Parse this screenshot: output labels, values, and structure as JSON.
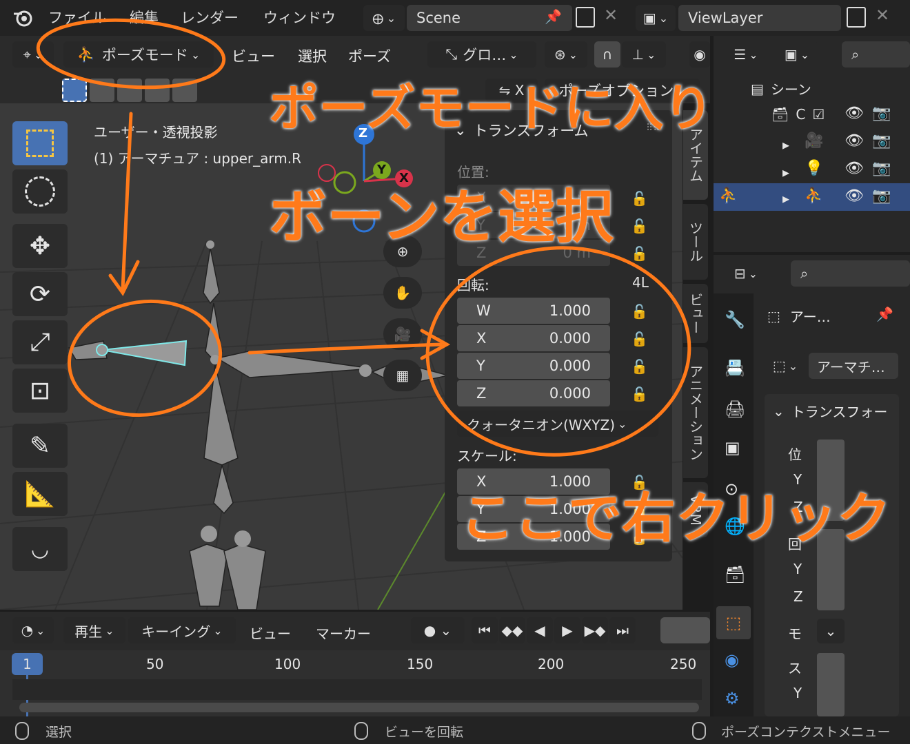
{
  "topbar": {
    "menus": [
      "ファイル",
      "編集",
      "レンダー",
      "ウィンドウ"
    ],
    "scene_name": "Scene",
    "view_layer": "ViewLayer"
  },
  "viewport_header": {
    "mode": "ポーズモード",
    "menus": [
      "ビュー",
      "選択",
      "ポーズ"
    ],
    "transform_orientation": "グロ…",
    "pose_options": "ポーズオプション"
  },
  "viewport": {
    "view_name": "ユーザー・透視投影",
    "object_label": "(1) アーマチュア : upper_arm.R",
    "gizmo_axes": [
      "Z",
      "Y",
      "X"
    ]
  },
  "npanel": {
    "section": "トランスフォーム",
    "location_label": "位置:",
    "location": [
      {
        "axis": "X",
        "value": "0 m"
      },
      {
        "axis": "Y",
        "value": "0 m"
      },
      {
        "axis": "Z",
        "value": "0 m"
      }
    ],
    "rotation_label": "回転:",
    "rotation_mode_short": "4L",
    "rotation": [
      {
        "axis": "W",
        "value": "1.000"
      },
      {
        "axis": "X",
        "value": "0.000"
      },
      {
        "axis": "Y",
        "value": "0.000"
      },
      {
        "axis": "Z",
        "value": "0.000"
      }
    ],
    "rotation_mode": "クォータニオン(WXYZ)",
    "scale_label": "スケール:",
    "scale": [
      {
        "axis": "X",
        "value": "1.000"
      },
      {
        "axis": "Y",
        "value": "1.000"
      },
      {
        "axis": "Z",
        "value": "1.000"
      }
    ],
    "tabs": [
      "アイテム",
      "ツール",
      "ビュー",
      "アニメーション",
      "VRM"
    ]
  },
  "timeline": {
    "menus": [
      "再生",
      "キーイング",
      "ビュー",
      "マーカー"
    ],
    "current_frame": "1",
    "ticks": [
      "50",
      "100",
      "150",
      "200",
      "250"
    ]
  },
  "status": {
    "left": "選択",
    "middle": "ビューを回転",
    "right": "ポーズコンテクストメニュー"
  },
  "outliner": {
    "scene_label": "シーン",
    "collection_label": "C"
  },
  "properties": {
    "object_name": "アー…",
    "data_name": "アーマチ…",
    "section": "トランスフォー",
    "rows": [
      "位",
      "Y",
      "Z",
      "回",
      "Y",
      "Z",
      "モ",
      "ス",
      "Y"
    ]
  },
  "annotations": {
    "note1": "ポーズモードに入り",
    "note2": "ボーンを選択",
    "note3": "ここで右クリック"
  },
  "colors": {
    "accent": "#4772b3",
    "annotation": "#ff7a1a",
    "selected_bone": "#7fe8e8"
  }
}
